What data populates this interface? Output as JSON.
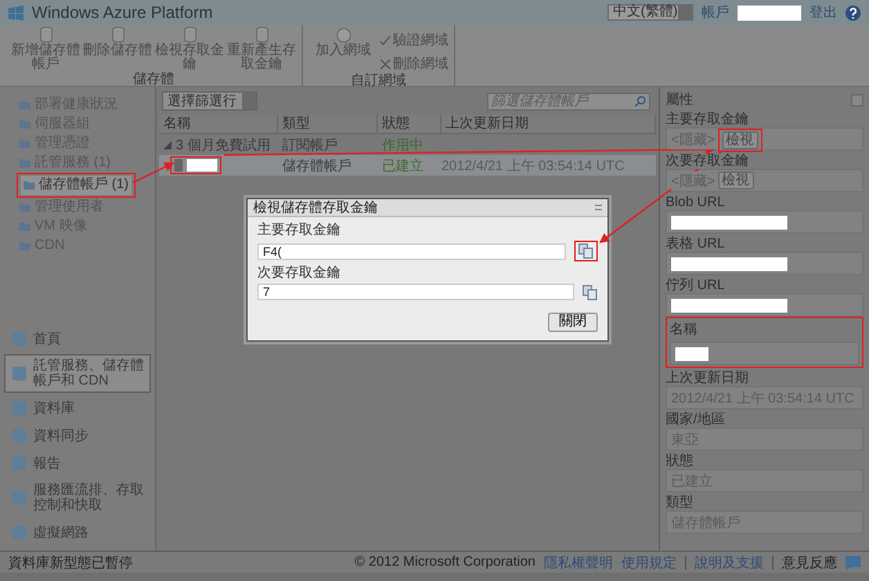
{
  "header": {
    "logo": "Windows Azure Platform",
    "language": "中文(繁體)",
    "account_link": "帳戶",
    "logout_link": "登出"
  },
  "ribbon": {
    "groups": [
      {
        "label": "儲存體",
        "buttons": [
          {
            "label": "新增儲存體帳戶",
            "kind": "large"
          },
          {
            "label": "刪除儲存體",
            "kind": "large"
          },
          {
            "label": "檢視存取金鑰",
            "kind": "large"
          },
          {
            "label": "重新產生存取金鑰",
            "kind": "large"
          }
        ]
      },
      {
        "label": "自訂網域",
        "buttons": [
          {
            "label": "加入網域",
            "kind": "large"
          },
          {
            "label": "驗證網域",
            "kind": "small"
          },
          {
            "label": "刪除網域",
            "kind": "small"
          }
        ]
      }
    ]
  },
  "sidebar": {
    "tree": [
      {
        "label": "部署健康狀況",
        "selected": false
      },
      {
        "label": "伺服器組",
        "selected": false
      },
      {
        "label": "管理憑證",
        "selected": false
      },
      {
        "label": "託管服務 (1)",
        "selected": false
      },
      {
        "label": "儲存體帳戶 (1)",
        "selected": true
      },
      {
        "label": "管理使用者",
        "selected": false
      },
      {
        "label": "VM 映像",
        "selected": false
      },
      {
        "label": "CDN",
        "selected": false
      }
    ],
    "nav": [
      {
        "label": "首頁",
        "selected": false
      },
      {
        "label": "託管服務、儲存體帳戶和 CDN",
        "selected": true
      },
      {
        "label": "資料庫",
        "selected": false
      },
      {
        "label": "資料同步",
        "selected": false
      },
      {
        "label": "報告",
        "selected": false
      },
      {
        "label": "服務匯流排、存取控制和快取",
        "selected": false
      },
      {
        "label": "虛擬網路",
        "selected": false
      }
    ]
  },
  "list": {
    "filter": "選擇篩選行",
    "search": {
      "placeholder": "篩選儲存體帳戶"
    },
    "columns": [
      "名稱",
      "類型",
      "狀態",
      "上次更新日期"
    ],
    "rows": [
      {
        "name": "3 個月免費試用",
        "type": "訂閱帳戶",
        "status": "作用中",
        "expanded": true,
        "selected": false,
        "children": [
          {
            "type": "儲存體帳戶",
            "status": "已建立",
            "updated": "2012/4/21 上午 03:54:14 UTC",
            "selected": true
          }
        ]
      }
    ]
  },
  "properties": {
    "title": "屬性",
    "items": [
      {
        "label": "主要存取金鑰",
        "kind": "key",
        "value": "<隱藏>",
        "button": "檢視"
      },
      {
        "label": "次要存取金鑰",
        "kind": "key",
        "value": "<隱藏>",
        "button": "檢視"
      },
      {
        "label": "Blob URL",
        "kind": "redacted"
      },
      {
        "label": "表格 URL",
        "kind": "redacted"
      },
      {
        "label": "佇列 URL",
        "kind": "redacted"
      },
      {
        "label": "名稱",
        "kind": "redacted"
      },
      {
        "label": "上次更新日期",
        "kind": "text",
        "value": "2012/4/21 上午 03:54:14 UTC"
      },
      {
        "label": "國家/地區",
        "kind": "text",
        "value": "東亞"
      },
      {
        "label": "狀態",
        "kind": "text",
        "value": "已建立"
      },
      {
        "label": "類型",
        "kind": "text",
        "value": "儲存體帳戶"
      }
    ]
  },
  "dialog": {
    "title": "檢視儲存體存取金鑰",
    "fields": [
      {
        "label": "主要存取金鑰",
        "value": "F4("
      },
      {
        "label": "次要存取金鑰",
        "value": "7"
      }
    ],
    "close_button": "關閉"
  },
  "footer": {
    "status": "資料庫新型態已暫停",
    "copyright": "© 2012 Microsoft Corporation",
    "links": [
      "隱私權聲明",
      "使用規定"
    ],
    "help": "說明及支援",
    "feedback": "意見反應"
  }
}
